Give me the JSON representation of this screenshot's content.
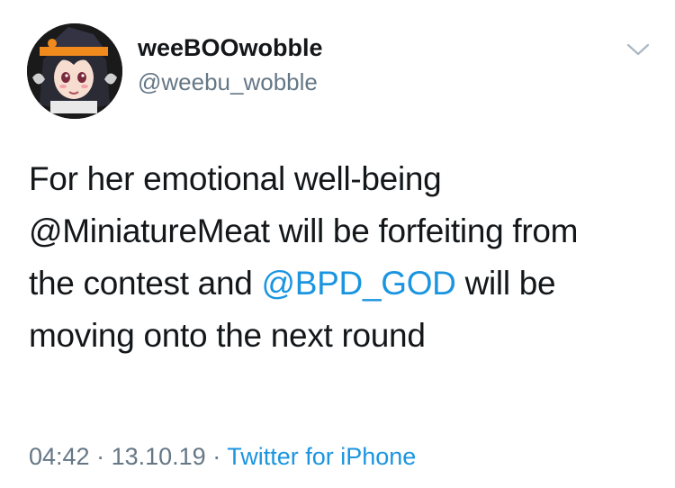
{
  "user": {
    "display_name": "weeBOOwobble",
    "handle": "@weebu_wobble",
    "avatar_icon": "avatar-icon"
  },
  "tweet": {
    "line1": "For her emotional well-being",
    "line2": "@MiniatureMeat will be forfeiting from",
    "line3_pre": "the contest and ",
    "mention": "@BPD_GOD",
    "line3_post": " will be",
    "line4": "moving onto the next round"
  },
  "meta": {
    "time": "04:42",
    "sep1": " · ",
    "date": "13.10.19",
    "sep2": " · ",
    "source": "Twitter for iPhone"
  },
  "colors": {
    "link": "#1b95e0",
    "secondary": "#657786",
    "text": "#14171a"
  }
}
